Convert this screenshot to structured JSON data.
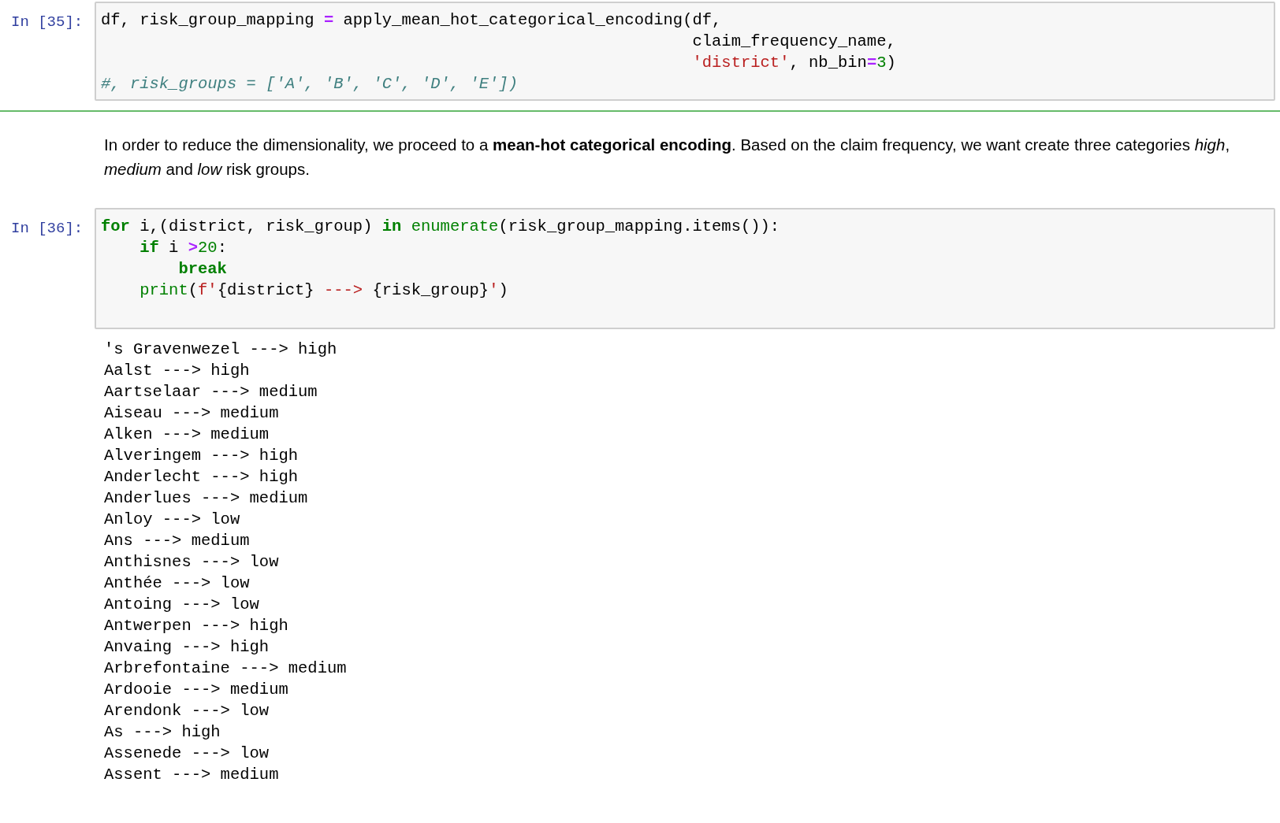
{
  "cells": [
    {
      "kind": "code",
      "prompt": "In [35]:",
      "lines": [
        {
          "kind": "flush",
          "tokens": [
            {
              "kind": "plain",
              "text": "df, risk_group_mapping "
            },
            {
              "kind": "operator",
              "text": "="
            },
            {
              "kind": "plain",
              "text": " apply_mean_hot_categorical_encoding(df,"
            }
          ]
        },
        {
          "kind": "continuation",
          "tokens": [
            {
              "kind": "plain",
              "text": "claim_frequency_name,"
            }
          ]
        },
        {
          "kind": "continuation",
          "tokens": [
            {
              "kind": "string",
              "text": "'district'"
            },
            {
              "kind": "plain",
              "text": ", nb_bin"
            },
            {
              "kind": "operator",
              "text": "="
            },
            {
              "kind": "number",
              "text": "3"
            },
            {
              "kind": "plain",
              "text": ")"
            }
          ]
        },
        {
          "kind": "flush",
          "tokens": [
            {
              "kind": "comment",
              "text": "#, risk_groups = ['A', 'B', 'C', 'D', 'E'])"
            }
          ]
        }
      ]
    },
    {
      "kind": "divider"
    },
    {
      "kind": "markdown",
      "text": "In order to reduce the dimensionality, we proceed to a **mean-hot categorical encoding**. Based on the claim frequency, we want create three categories *high*, *medium* and *low* risk groups."
    },
    {
      "kind": "code",
      "prompt": "In [36]:",
      "lines": [
        {
          "kind": "flush",
          "tokens": [
            {
              "kind": "keyword",
              "text": "for"
            },
            {
              "kind": "plain",
              "text": " i,(district, risk_group) "
            },
            {
              "kind": "keyword",
              "text": "in"
            },
            {
              "kind": "builtin",
              "text": " enumerate"
            },
            {
              "kind": "plain",
              "text": "(risk_group_mapping.items()):"
            }
          ]
        },
        {
          "kind": "indented",
          "tokens": [
            {
              "kind": "keyword",
              "text": "if"
            },
            {
              "kind": "plain",
              "text": " i "
            },
            {
              "kind": "operator",
              "text": ">"
            },
            {
              "kind": "number",
              "text": "20"
            },
            {
              "kind": "plain",
              "text": ":"
            }
          ]
        },
        {
          "kind": "nested",
          "tokens": [
            {
              "kind": "keyword",
              "text": "break"
            }
          ]
        },
        {
          "kind": "indented",
          "tokens": [
            {
              "kind": "builtin",
              "text": "print"
            },
            {
              "kind": "plain",
              "text": "("
            },
            {
              "kind": "string",
              "text": "f'"
            },
            {
              "kind": "plain",
              "text": "{district} "
            },
            {
              "kind": "string",
              "text": "--->"
            },
            {
              "kind": "plain",
              "text": " {risk_group}"
            },
            {
              "kind": "string",
              "text": "'"
            },
            {
              "kind": "plain",
              "text": ")"
            }
          ]
        }
      ]
    },
    {
      "kind": "output",
      "lines": [
        "'s Gravenwezel ---> high",
        "Aalst ---> high",
        "Aartselaar ---> medium",
        "Aiseau ---> medium",
        "Alken ---> medium",
        "Alveringem ---> high",
        "Anderlecht ---> high",
        "Anderlues ---> medium",
        "Anloy ---> low",
        "Ans ---> medium",
        "Anthisnes ---> low",
        "Anthée ---> low",
        "Antoing ---> low",
        "Antwerpen ---> high",
        "Anvaing ---> high",
        "Arbrefontaine ---> medium",
        "Ardooie ---> medium",
        "Arendonk ---> low",
        "As ---> high",
        "Assenede ---> low",
        "Assent ---> medium"
      ]
    }
  ]
}
